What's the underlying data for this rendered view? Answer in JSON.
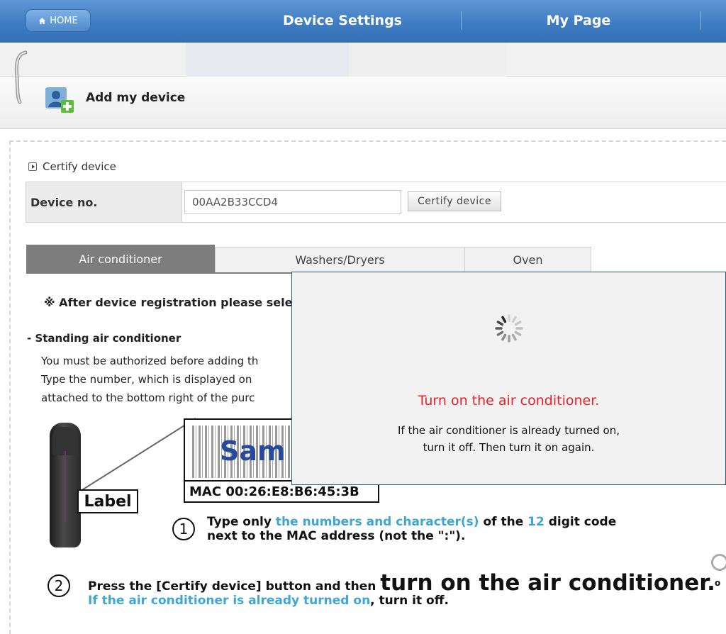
{
  "nav": {
    "home_label": "HOME",
    "tabs": [
      {
        "label": "Device Settings"
      },
      {
        "label": "My Page"
      }
    ]
  },
  "header": {
    "title": "Add my device"
  },
  "certify": {
    "section_title": "Certify device",
    "field_label": "Device no.",
    "device_value": "00AA2B33CCD4",
    "button_label": "Certify device"
  },
  "device_tabs": [
    {
      "label": "Air conditioner",
      "active": true
    },
    {
      "label": "Washers/Dryers",
      "active": false
    },
    {
      "label": "Oven",
      "active": false
    }
  ],
  "content": {
    "note": "※ After device registration please selec",
    "sub_head": "- Standing air conditioner",
    "lines": [
      "You must be authorized before adding th",
      "Type the number, which is displayed on",
      "attached to the bottom right of the purc"
    ],
    "figure": {
      "label": "Label",
      "brand_text": "Sam",
      "mac_text": "MAC 00:26:E8:B6:45:3B"
    },
    "step1": {
      "number": "1",
      "part1": "Type only ",
      "part2": "the numbers and character(s)",
      "part3": " of the ",
      "part4": "12",
      "part5": " digit code",
      "line2": "next to the MAC address (not the \":\")."
    },
    "step2": {
      "number": "2",
      "part1": "Press the [Certify device] button and then ",
      "part2": "turn on the air conditioner.",
      "line2_highlight": "If the air conditioner is already turned on",
      "line2_rest": ", turn it off.",
      "corner_text": "o"
    }
  },
  "modal": {
    "alert": "Turn on the air conditioner.",
    "line1": "If the air conditioner is already turned on,",
    "line2": "turn it off. Then turn it on again."
  },
  "colors": {
    "nav_blue": "#3f7cc1",
    "alert_red": "#e8202a",
    "highlight_blue": "#3fa6d2",
    "tab_active": "#7d7d7d"
  }
}
